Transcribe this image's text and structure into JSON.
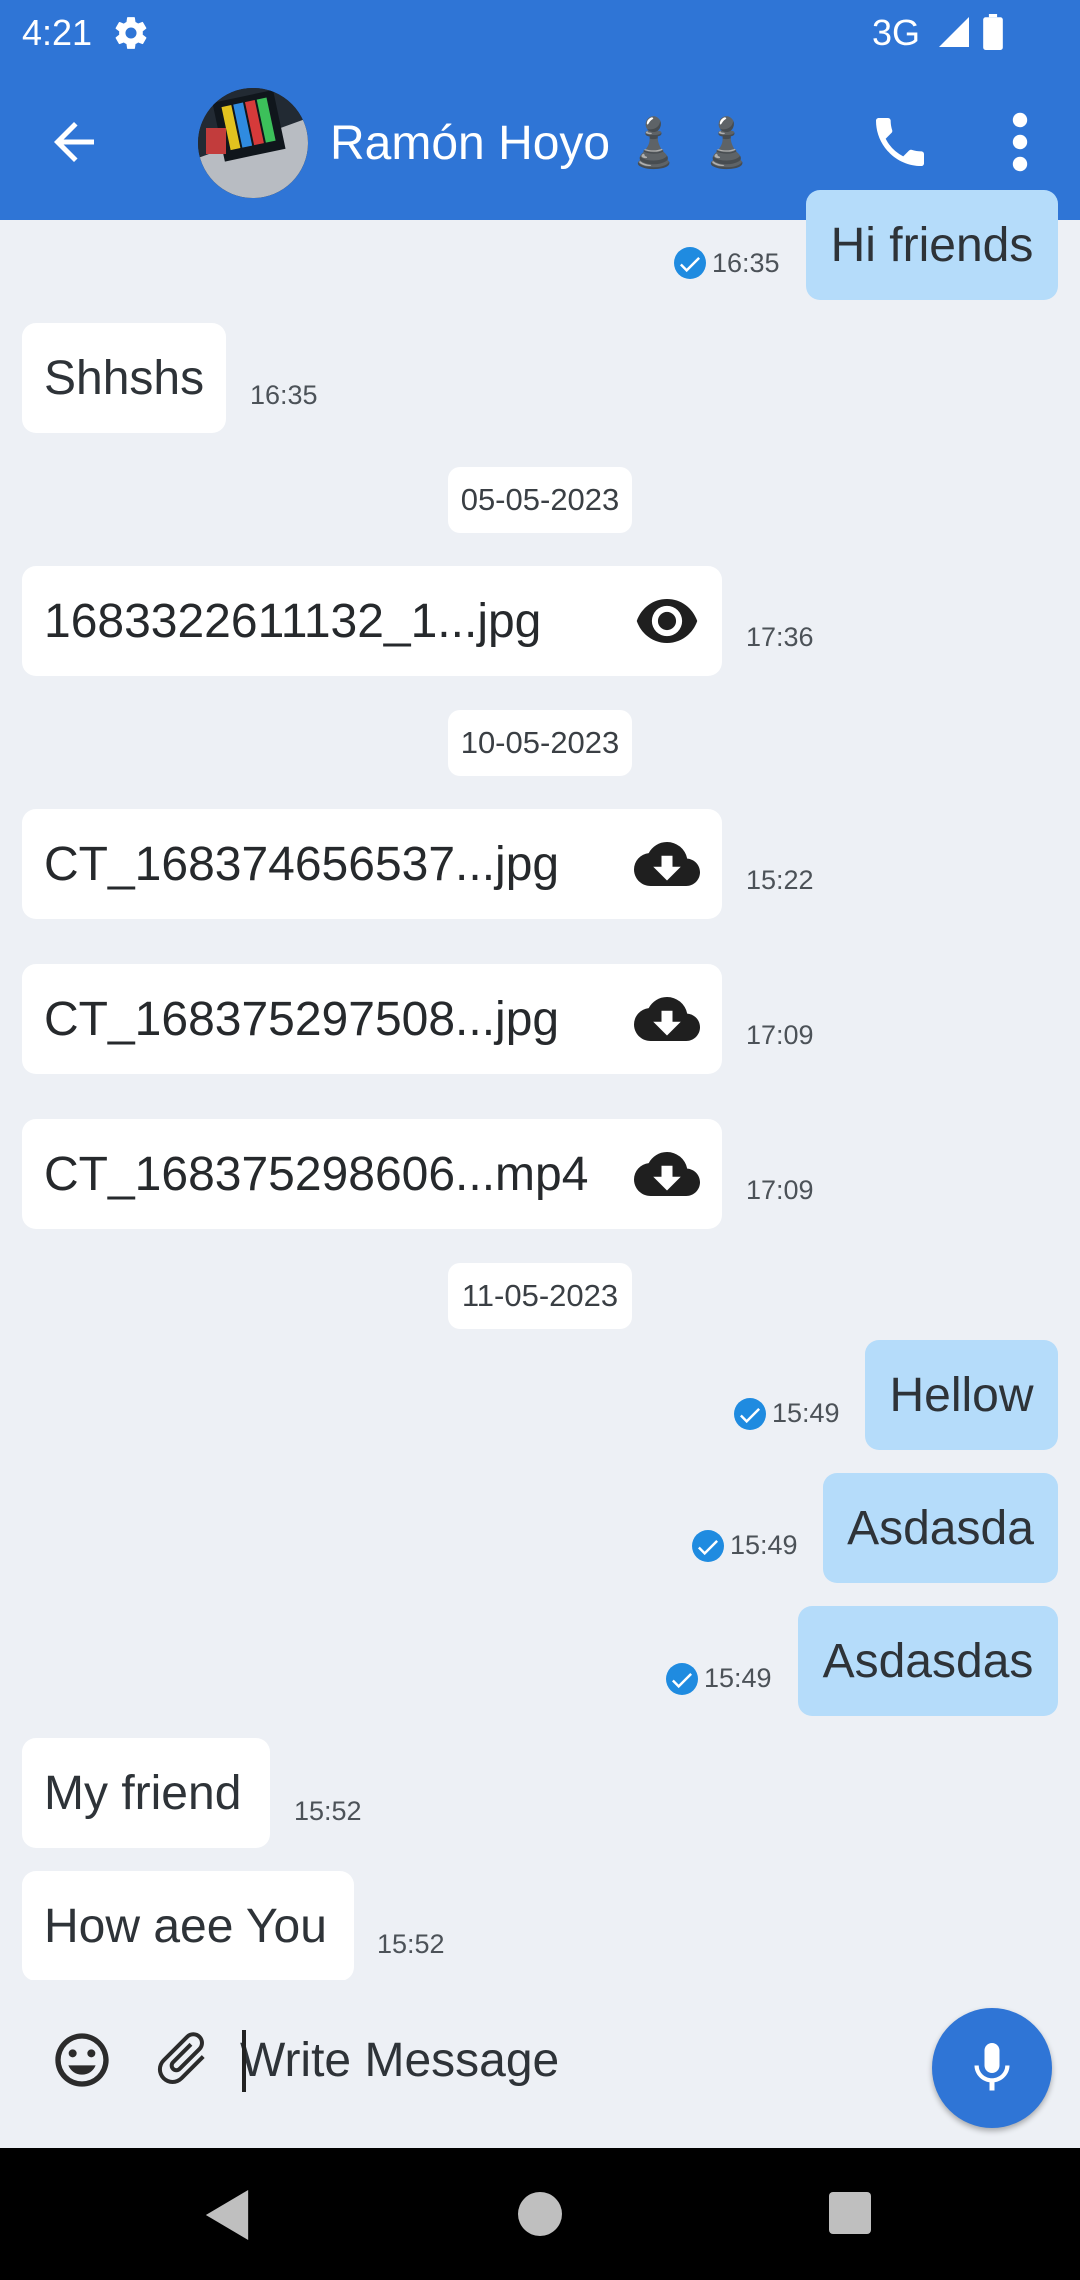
{
  "status_bar": {
    "time": "4:21",
    "network": "3G"
  },
  "app_bar": {
    "contact_name": "Ramón Hoyo ♟️ ♟️"
  },
  "messages": {
    "m1": {
      "text": "Hi friends",
      "time": "16:35"
    },
    "m2": {
      "text": "Shhshs",
      "time": "16:35"
    },
    "date1": "05-05-2023",
    "f1": {
      "name": "1683322611132_1...jpg",
      "icon": "eye-icon",
      "time": "17:36"
    },
    "date2": "10-05-2023",
    "f2": {
      "name": "CT_168374656537...jpg",
      "icon": "cloud-download-icon",
      "time": "15:22"
    },
    "f3": {
      "name": "CT_168375297508...jpg",
      "icon": "cloud-download-icon",
      "time": "17:09"
    },
    "f4": {
      "name": "CT_168375298606...mp4",
      "icon": "cloud-download-icon",
      "time": "17:09"
    },
    "date3": "11-05-2023",
    "m3": {
      "text": "Hellow",
      "time": "15:49"
    },
    "m4": {
      "text": "Asdasda",
      "time": "15:49"
    },
    "m5": {
      "text": "Asdasdas",
      "time": "15:49"
    },
    "m6": {
      "text": "My friend",
      "time": "15:52"
    },
    "m7": {
      "text": "How aee You",
      "time": "15:52"
    }
  },
  "input": {
    "placeholder": "Write Message"
  },
  "colors": {
    "primary": "#2f75d6",
    "outgoing_bubble": "#b5dcfa",
    "incoming_bubble": "#ffffff",
    "background": "#edf0f5",
    "read_check": "#1f8be0"
  }
}
